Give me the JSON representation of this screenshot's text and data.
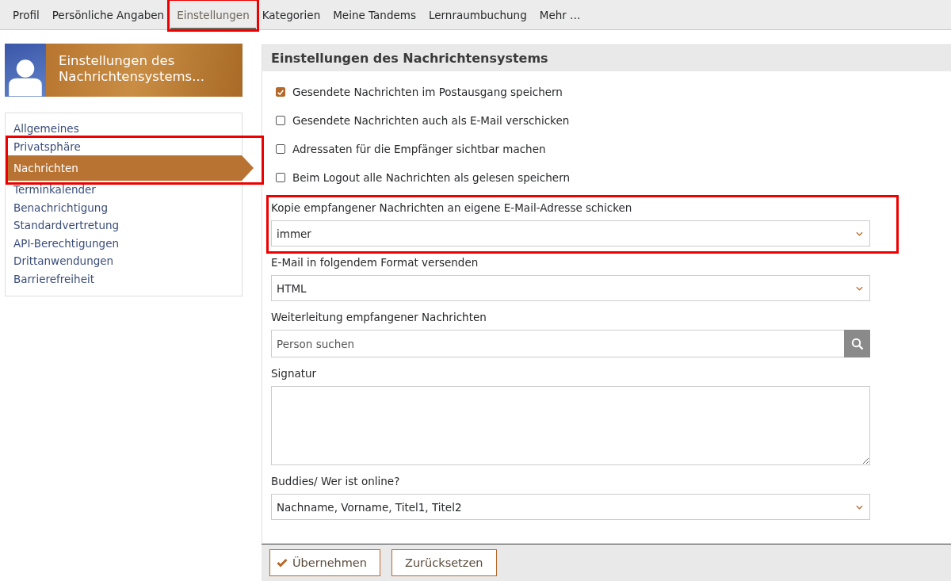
{
  "tabs": [
    {
      "label": "Profil",
      "selected": false,
      "highlighted": false
    },
    {
      "label": "Persönliche Angaben",
      "selected": false,
      "highlighted": false
    },
    {
      "label": "Einstellungen",
      "selected": true,
      "highlighted": true
    },
    {
      "label": "Kategorien",
      "selected": false,
      "highlighted": false
    },
    {
      "label": "Meine Tandems",
      "selected": false,
      "highlighted": false
    },
    {
      "label": "Lernraumbuchung",
      "selected": false,
      "highlighted": false
    },
    {
      "label": "Mehr …",
      "selected": false,
      "highlighted": false
    }
  ],
  "sidebar": {
    "title": "Einstellungen des Nachrichtensystems...",
    "items": [
      {
        "label": "Allgemeines",
        "selected": false,
        "highlighted": false
      },
      {
        "label": "Privatsphäre",
        "selected": false,
        "highlighted": true
      },
      {
        "label": "Nachrichten",
        "selected": true,
        "highlighted": true
      },
      {
        "label": "Terminkalender",
        "selected": false,
        "highlighted": false
      },
      {
        "label": "Benachrichtigung",
        "selected": false,
        "highlighted": false
      },
      {
        "label": "Standardvertretung",
        "selected": false,
        "highlighted": false
      },
      {
        "label": "API-Berechtigungen",
        "selected": false,
        "highlighted": false
      },
      {
        "label": "Drittanwendungen",
        "selected": false,
        "highlighted": false
      },
      {
        "label": "Barrierefreiheit",
        "selected": false,
        "highlighted": false
      }
    ]
  },
  "panel": {
    "title": "Einstellungen des Nachrichtensystems",
    "fields": [
      {
        "kind": "checkbox",
        "label": "Gesendete Nachrichten im Postausgang speichern",
        "checked": true
      },
      {
        "kind": "checkbox",
        "label": "Gesendete Nachrichten auch als E-Mail verschicken",
        "checked": false
      },
      {
        "kind": "checkbox",
        "label": "Adressaten für die Empfänger sichtbar machen",
        "checked": false
      },
      {
        "kind": "checkbox",
        "label": "Beim Logout alle Nachrichten als gelesen speichern",
        "checked": false
      },
      {
        "kind": "select",
        "label": "Kopie empfangener Nachrichten an eigene E-Mail-Adresse schicken",
        "value": "immer",
        "highlighted": true
      },
      {
        "kind": "select",
        "label": "E-Mail in folgendem Format versenden",
        "value": "HTML",
        "highlighted": false
      },
      {
        "kind": "search",
        "label": "Weiterleitung empfangener Nachrichten",
        "placeholder": "Person suchen",
        "highlighted": false
      },
      {
        "kind": "textarea",
        "label": "Signatur",
        "highlighted": false
      },
      {
        "kind": "select",
        "label": "Buddies/ Wer ist online?",
        "value": "Nachname, Vorname, Titel1, Titel2",
        "highlighted": false
      }
    ]
  },
  "buttons": [
    {
      "label": "Übernehmen",
      "kind": "accept"
    },
    {
      "label": "Zurücksetzen",
      "kind": "reset"
    }
  ]
}
